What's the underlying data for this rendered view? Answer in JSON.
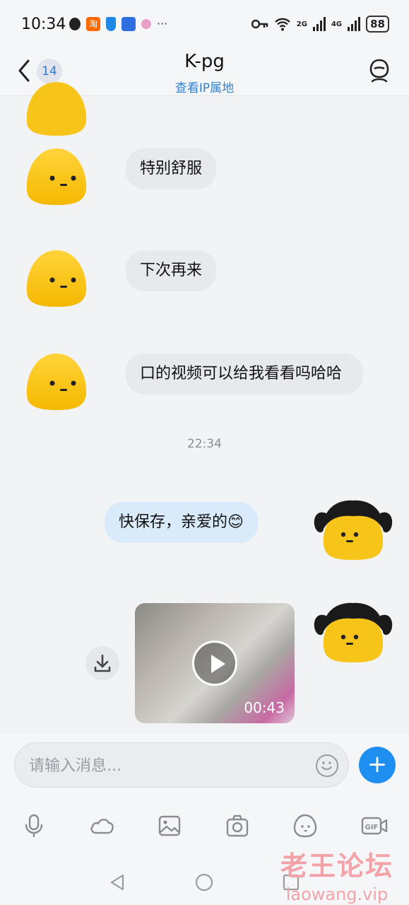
{
  "status_bar": {
    "time": "10:34",
    "taobao_badge": "淘",
    "more": "···",
    "net_2g": "2G",
    "net_4g": "4G",
    "battery": "88"
  },
  "header": {
    "unread_count": "14",
    "title": "K-pg",
    "subtitle": "查看IP属地"
  },
  "messages": {
    "m1": "特别舒服",
    "m2": "下次再来",
    "m3": "口的视频可以给我看看吗哈哈",
    "timestamp": "22:34",
    "m4": "快保存，亲爱的😊",
    "video_duration": "00:43"
  },
  "input": {
    "placeholder": "请输入消息...",
    "plus_label": "+"
  },
  "watermark": {
    "cn": "老王论坛",
    "en": "laowang.vip"
  },
  "colors": {
    "accent": "#1e8ff0",
    "link": "#2f80d0",
    "bubble_in": "#e8e9ec",
    "bubble_out": "#d9ebfb",
    "avatar_yellow": "#f7c51a"
  }
}
